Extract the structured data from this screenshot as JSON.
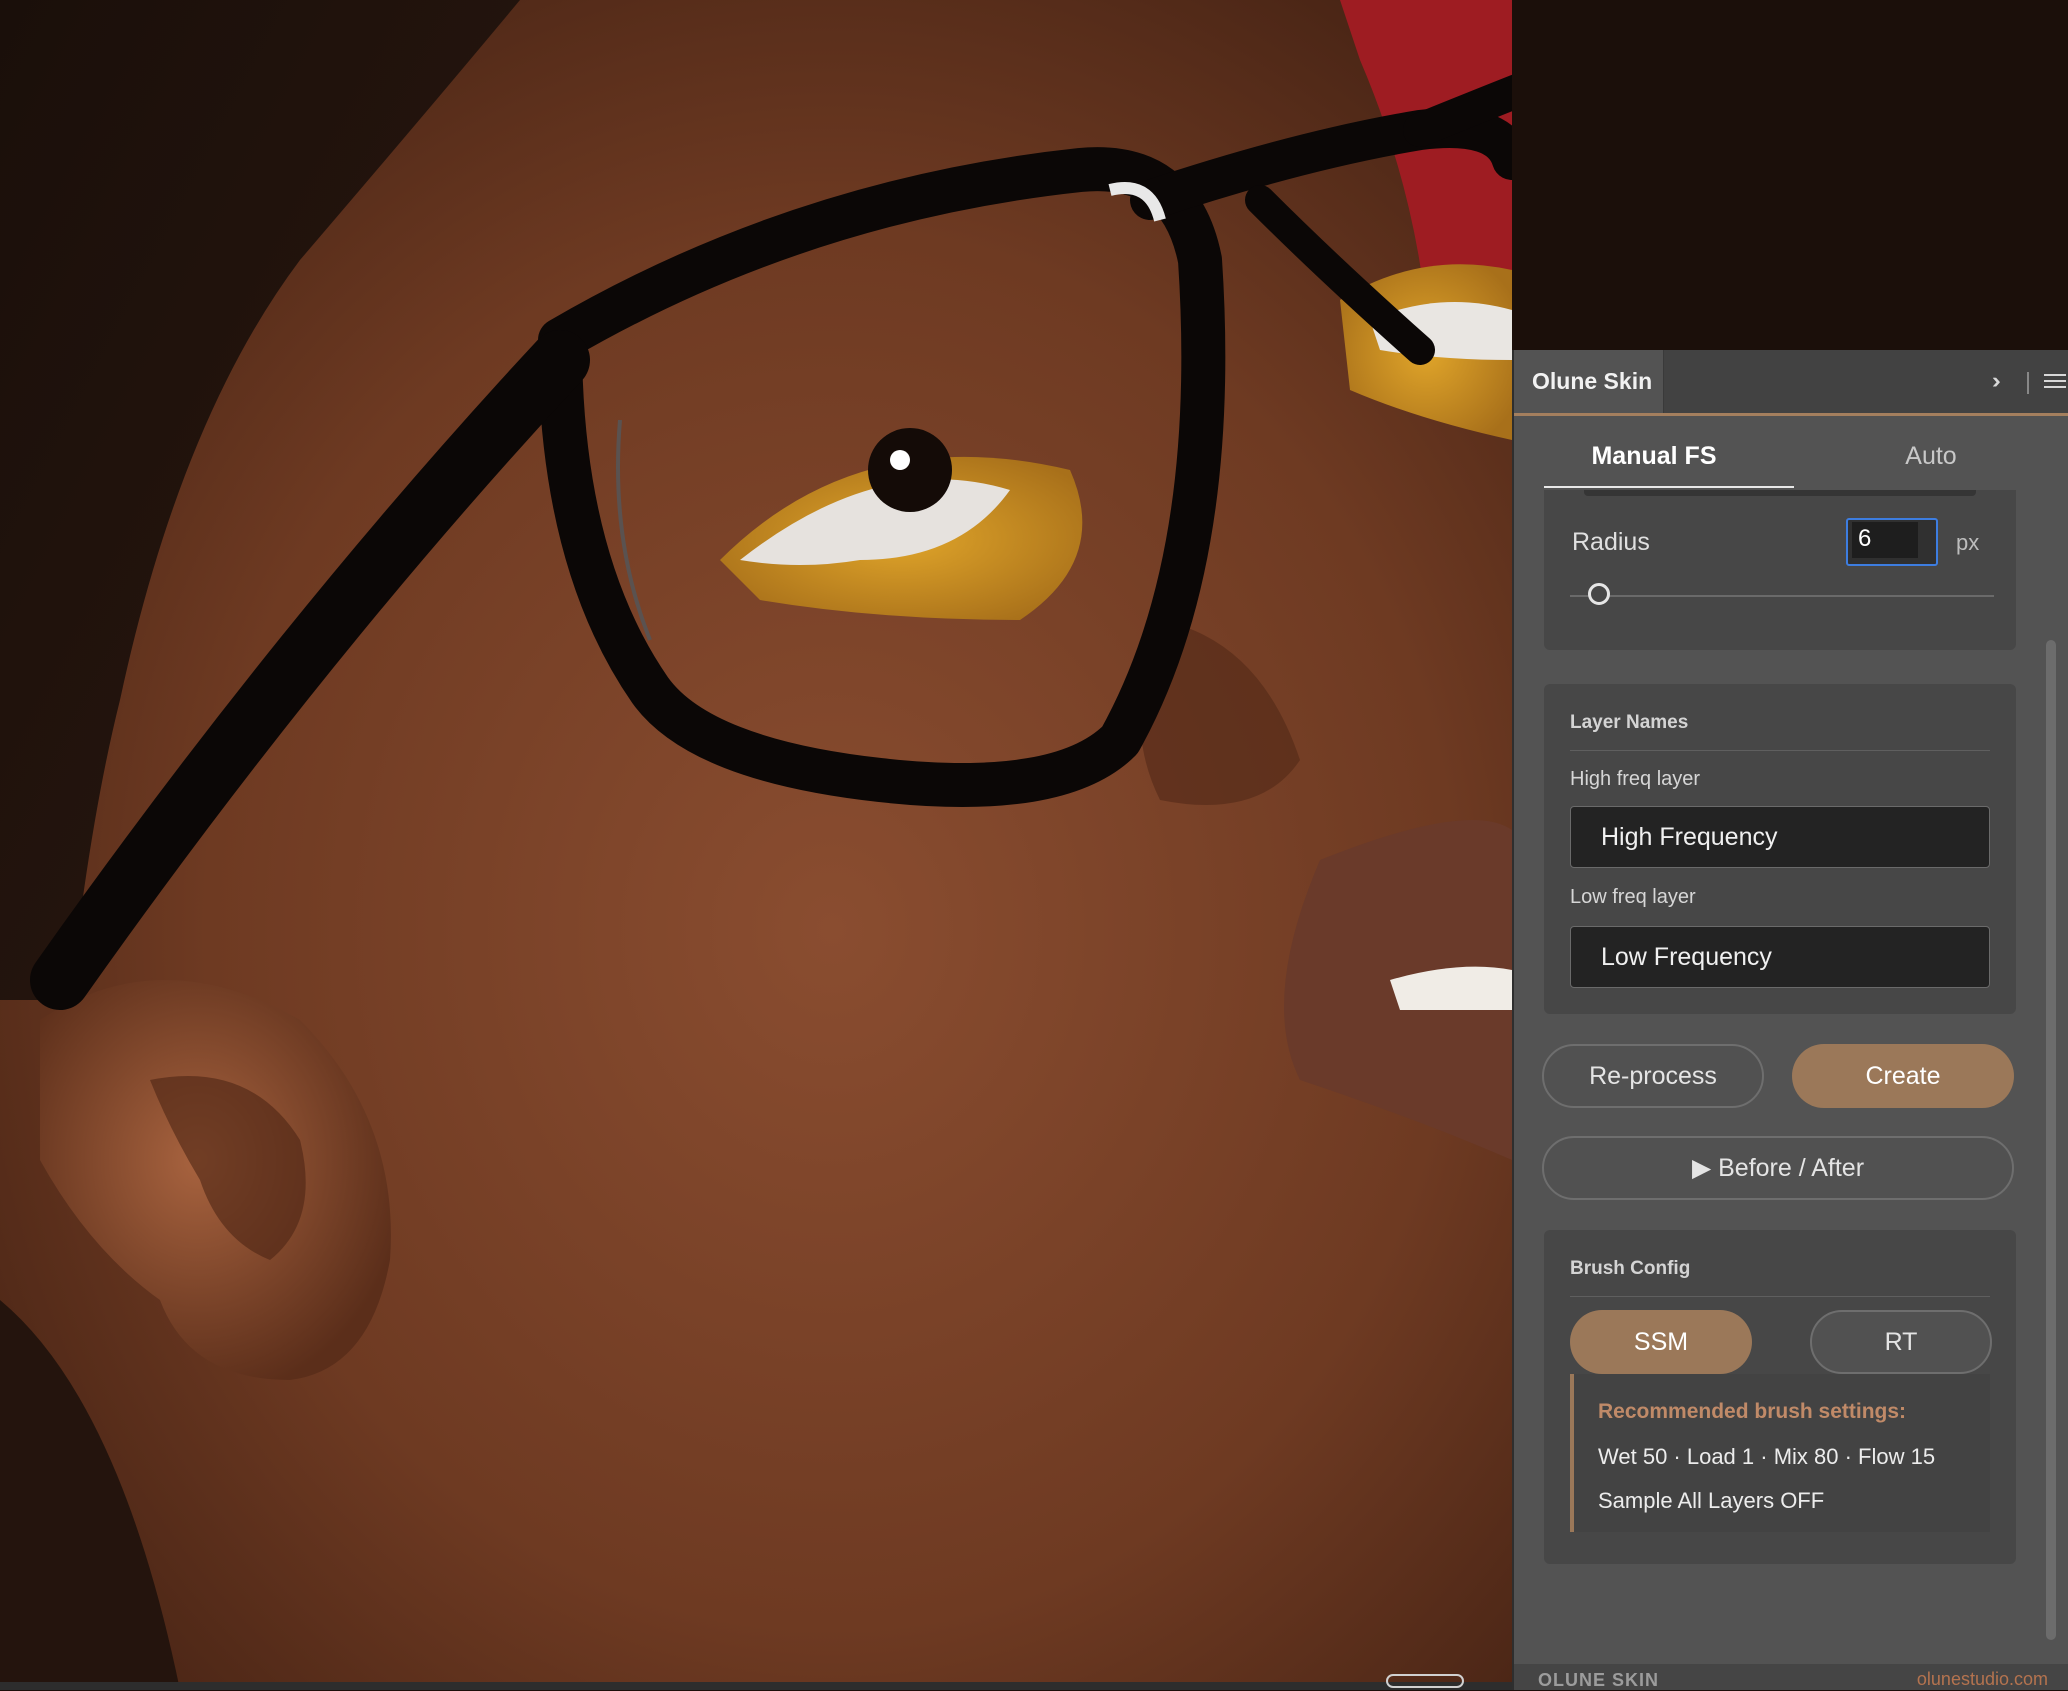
{
  "panel": {
    "title": "Olune Skin",
    "tabs": [
      "Manual FS",
      "Auto"
    ],
    "radius": {
      "label": "Radius",
      "value": "6",
      "unit": "px"
    },
    "layer_names": {
      "title": "Layer Names",
      "high_label": "High freq layer",
      "high_value": "High Frequency",
      "low_label": "Low freq layer",
      "low_value": "Low Frequency"
    },
    "buttons": {
      "reprocess": "Re-process",
      "create": "Create",
      "before_after": "▶ Before / After"
    },
    "brush_config": {
      "title": "Brush Config",
      "ssm": "SSM",
      "rt": "RT",
      "rec_title": "Recommended brush settings:",
      "rec_line1": "Wet 50 · Load 1 · Mix 80 · Flow 15",
      "rec_line2": "Sample All Layers OFF"
    },
    "footer": {
      "brand": "OLUNE SKIN",
      "url": "olunestudio.com"
    }
  },
  "colors": {
    "accent": "#9b7859",
    "focus": "#3d7de0",
    "panel_bg": "#535353",
    "backdrop": "#9e1c22"
  },
  "icons": {
    "collapse": "double-chevron-right-icon",
    "menu": "hamburger-menu-icon"
  }
}
